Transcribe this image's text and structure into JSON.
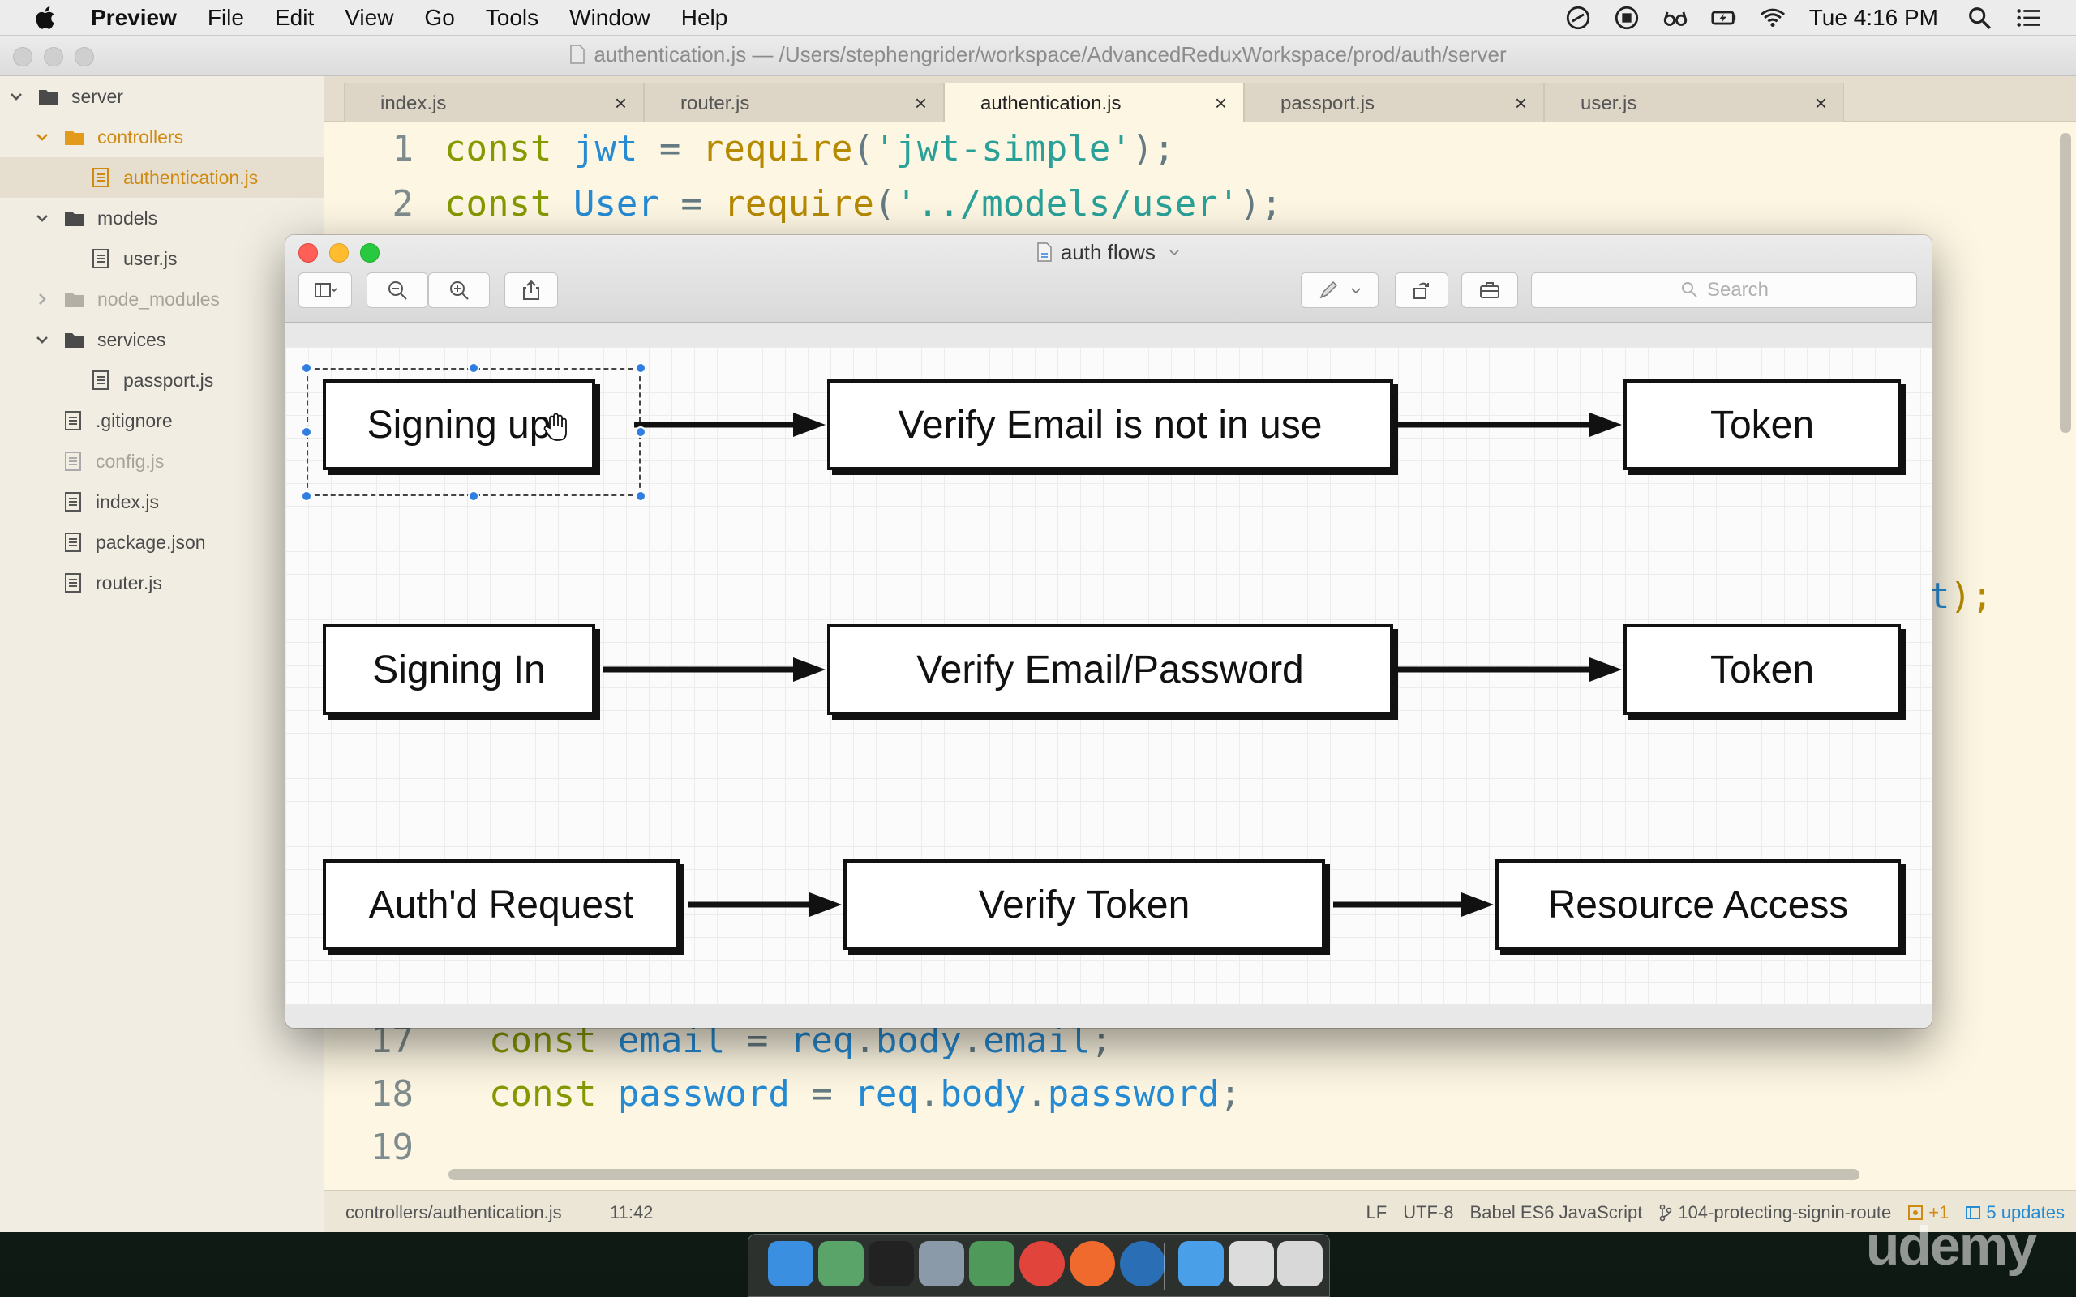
{
  "menubar": {
    "app_name": "Preview",
    "items": [
      "File",
      "Edit",
      "View",
      "Go",
      "Tools",
      "Window",
      "Help"
    ],
    "clock": "Tue 4:16 PM"
  },
  "editor": {
    "title": "authentication.js — /Users/stephengrider/workspace/AdvancedReduxWorkspace/prod/auth/server",
    "tree": [
      {
        "label": "server",
        "kind": "folder",
        "state": "open"
      },
      {
        "label": "controllers",
        "kind": "folder",
        "state": "open",
        "modified": true
      },
      {
        "label": "authentication.js",
        "kind": "file",
        "selected": true,
        "modified": true
      },
      {
        "label": "models",
        "kind": "folder",
        "state": "open"
      },
      {
        "label": "user.js",
        "kind": "file"
      },
      {
        "label": "node_modules",
        "kind": "folder",
        "state": "closed",
        "ignored": true
      },
      {
        "label": "services",
        "kind": "folder",
        "state": "open"
      },
      {
        "label": "passport.js",
        "kind": "file"
      },
      {
        "label": ".gitignore",
        "kind": "file"
      },
      {
        "label": "config.js",
        "kind": "file",
        "ignored": true
      },
      {
        "label": "index.js",
        "kind": "file"
      },
      {
        "label": "package.json",
        "kind": "file"
      },
      {
        "label": "router.js",
        "kind": "file"
      }
    ],
    "tabs": [
      {
        "label": "index.js",
        "active": false
      },
      {
        "label": "router.js",
        "active": false
      },
      {
        "label": "authentication.js",
        "active": true
      },
      {
        "label": "passport.js",
        "active": false
      },
      {
        "label": "user.js",
        "active": false
      }
    ],
    "tab_close": "×",
    "code_lines": [
      {
        "num": "1",
        "tokens": [
          [
            "kw",
            "const "
          ],
          [
            "var",
            "jwt"
          ],
          [
            "op",
            " = "
          ],
          [
            "fn",
            "require"
          ],
          [
            "op",
            "("
          ],
          [
            "str",
            "'jwt-simple'"
          ],
          [
            "op",
            ");"
          ]
        ]
      },
      {
        "num": "2",
        "tokens": [
          [
            "kw",
            "const "
          ],
          [
            "var",
            "User"
          ],
          [
            "op",
            " = "
          ],
          [
            "fn",
            "require"
          ],
          [
            "op",
            "("
          ],
          [
            "str",
            "'../models/user'"
          ],
          [
            "op",
            ");"
          ]
        ]
      },
      {
        "num": "17",
        "tokens": [
          [
            "kw",
            "  const "
          ],
          [
            "var",
            "email"
          ],
          [
            "op",
            " = "
          ],
          [
            "var",
            "req"
          ],
          [
            "op",
            "."
          ],
          [
            "var",
            "body"
          ],
          [
            "op",
            "."
          ],
          [
            "var",
            "email"
          ],
          [
            "op",
            ";"
          ]
        ]
      },
      {
        "num": "18",
        "tokens": [
          [
            "kw",
            "  const "
          ],
          [
            "var",
            "password"
          ],
          [
            "op",
            " = "
          ],
          [
            "var",
            "req"
          ],
          [
            "op",
            "."
          ],
          [
            "var",
            "body"
          ],
          [
            "op",
            "."
          ],
          [
            "var",
            "password"
          ],
          [
            "op",
            ";"
          ]
        ]
      },
      {
        "num": "19",
        "tokens": []
      }
    ],
    "code_fragment": {
      "var": "t",
      "rest": ");"
    },
    "statusbar": {
      "file_path": "controllers/authentication.js",
      "cursor": "11:42",
      "line_ending": "LF",
      "encoding": "UTF-8",
      "grammar": "Babel ES6 JavaScript",
      "branch": "104-protecting-signin-route",
      "changes": "+1",
      "updates": "5 updates"
    }
  },
  "preview": {
    "title": "auth flows",
    "search_placeholder": "Search",
    "flows": [
      {
        "steps": [
          "Signing up",
          "Verify Email is not in use",
          "Token"
        ]
      },
      {
        "steps": [
          "Signing In",
          "Verify Email/Password",
          "Token"
        ]
      },
      {
        "steps": [
          "Auth'd Request",
          "Verify Token",
          "Resource Access"
        ]
      }
    ]
  },
  "dock": {
    "apps": [
      {
        "name": "finder-icon",
        "color": "#3b8fe0"
      },
      {
        "name": "atom-icon",
        "color": "#5aa469"
      },
      {
        "name": "terminal-icon",
        "color": "#222222"
      },
      {
        "name": "preview-icon",
        "color": "#8a9aa8"
      },
      {
        "name": "sourcetree-icon",
        "color": "#4f9a5a"
      },
      {
        "name": "chrome-icon",
        "color": "#e0443a"
      },
      {
        "name": "postman-icon",
        "color": "#f06a2e"
      },
      {
        "name": "quicktime-icon",
        "color": "#2a6fb5"
      },
      {
        "name": "folder-icon",
        "color": "#4aa0e8"
      },
      {
        "name": "document-icon",
        "color": "#dcdcdc"
      },
      {
        "name": "trash-icon",
        "color": "#d8d8d8"
      }
    ]
  },
  "watermark": "udemy"
}
